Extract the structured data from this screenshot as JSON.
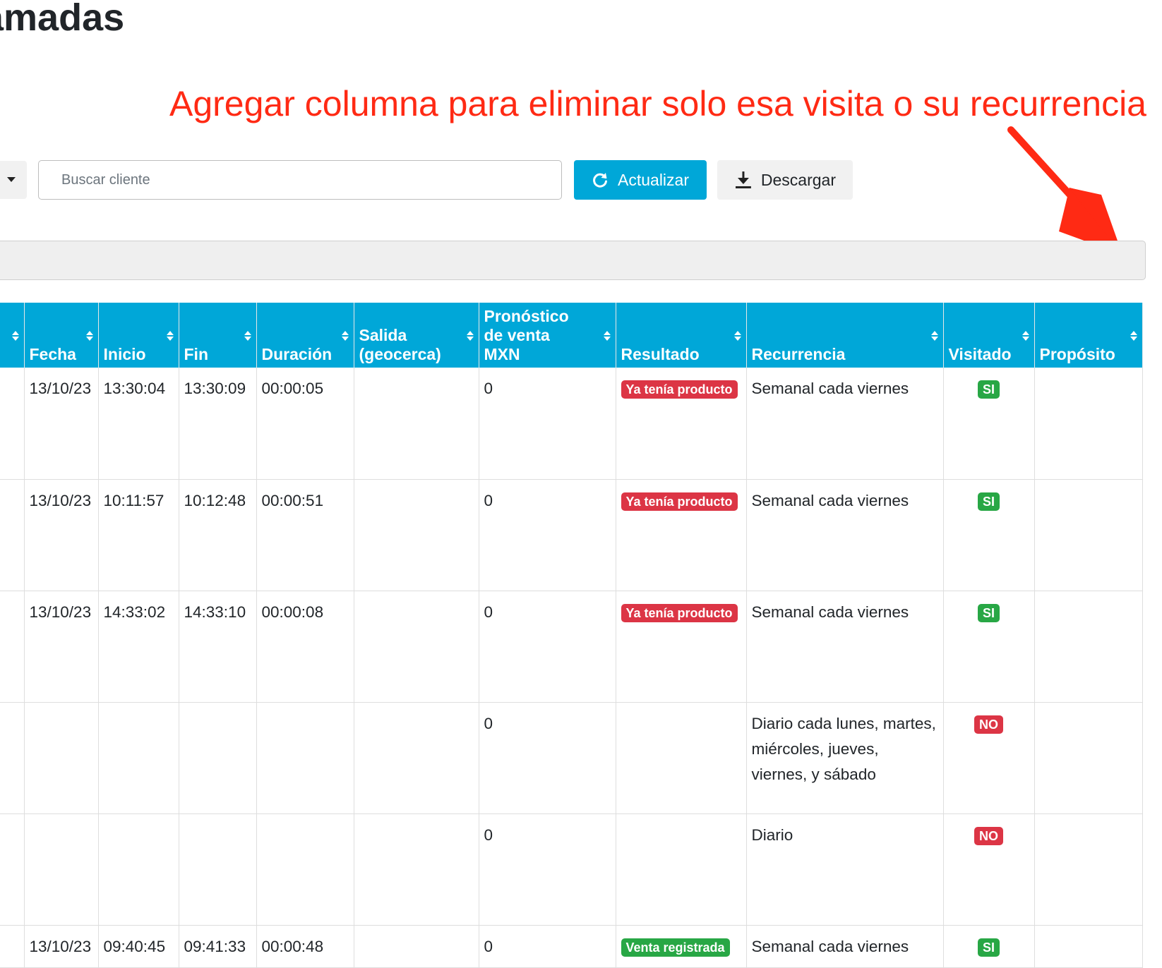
{
  "page": {
    "title": "ramadas"
  },
  "annotation": {
    "text": "Agregar columna para eliminar solo esa visita o su recurrencia"
  },
  "toolbar": {
    "search_placeholder": "Buscar cliente",
    "refresh_label": "Actualizar",
    "download_label": "Descargar"
  },
  "colors": {
    "header_bg": "#00a7d8",
    "annotation": "#ff2a14",
    "badge_red": "#dc3545",
    "badge_green": "#28a745"
  },
  "table": {
    "headers": [
      "",
      "Fecha",
      "Inicio",
      "Fin",
      "Duración",
      "Salida (geocerca)",
      "Pronóstico de venta MXN",
      "Resultado",
      "Recurrencia",
      "Visitado",
      "Propósito"
    ],
    "rows": [
      {
        "fecha": "13/10/23",
        "inicio": "13:30:04",
        "fin": "13:30:09",
        "duracion": "00:00:05",
        "salida": "",
        "pronostico": "0",
        "resultado": "Ya tenía producto",
        "resultado_color": "red",
        "recurrencia": "Semanal cada viernes",
        "visitado": "SI",
        "visitado_color": "green",
        "proposito": ""
      },
      {
        "fecha": "13/10/23",
        "inicio": "10:11:57",
        "fin": "10:12:48",
        "duracion": "00:00:51",
        "salida": "",
        "pronostico": "0",
        "resultado": "Ya tenía producto",
        "resultado_color": "red",
        "recurrencia": "Semanal cada viernes",
        "visitado": "SI",
        "visitado_color": "green",
        "proposito": ""
      },
      {
        "fecha": "13/10/23",
        "inicio": "14:33:02",
        "fin": "14:33:10",
        "duracion": "00:00:08",
        "salida": "",
        "pronostico": "0",
        "resultado": "Ya tenía producto",
        "resultado_color": "red",
        "recurrencia": "Semanal cada viernes",
        "visitado": "SI",
        "visitado_color": "green",
        "proposito": ""
      },
      {
        "fecha": "",
        "inicio": "",
        "fin": "",
        "duracion": "",
        "salida": "",
        "pronostico": "0",
        "resultado": "",
        "resultado_color": "",
        "recurrencia": "Diario cada lunes, martes, miércoles, jueves, viernes, y sábado",
        "visitado": "NO",
        "visitado_color": "red",
        "proposito": ""
      },
      {
        "fecha": "",
        "inicio": "",
        "fin": "",
        "duracion": "",
        "salida": "",
        "pronostico": "0",
        "resultado": "",
        "resultado_color": "",
        "recurrencia": "Diario",
        "visitado": "NO",
        "visitado_color": "red",
        "proposito": ""
      },
      {
        "fecha": "13/10/23",
        "inicio": "09:40:45",
        "fin": "09:41:33",
        "duracion": "00:00:48",
        "salida": "",
        "pronostico": "0",
        "resultado": "Venta registrada",
        "resultado_color": "green",
        "recurrencia": "Semanal cada viernes",
        "visitado": "SI",
        "visitado_color": "green",
        "proposito": ""
      }
    ]
  }
}
